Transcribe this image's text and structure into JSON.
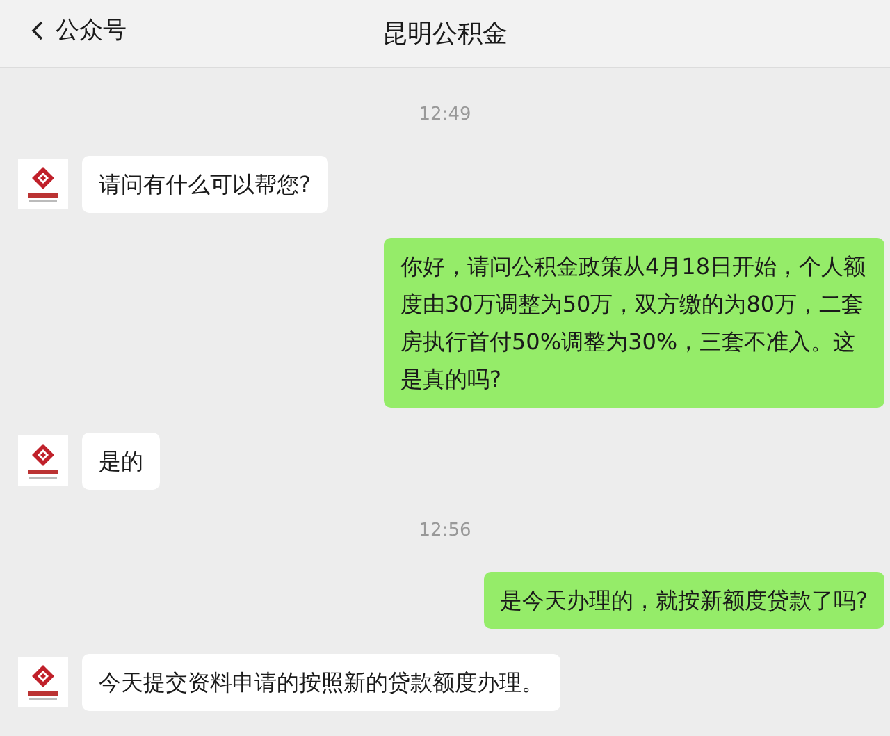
{
  "header": {
    "back_label": "公众号",
    "title": "昆明公积金"
  },
  "messages": [
    {
      "kind": "time",
      "text": "12:49"
    },
    {
      "kind": "received",
      "text": "请问有什么可以帮您?"
    },
    {
      "kind": "sent",
      "text": "你好，请问公积金政策从4月18日开始，个人额度由30万调整为50万，双方缴的为80万，二套房执行首付50%调整为30%，三套不准入。这是真的吗?"
    },
    {
      "kind": "received",
      "text": "是的"
    },
    {
      "kind": "time",
      "text": "12:56"
    },
    {
      "kind": "sent",
      "text": "是今天办理的，就按新额度贷款了吗?"
    },
    {
      "kind": "received",
      "text": "今天提交资料申请的按照新的贷款额度办理。"
    }
  ]
}
